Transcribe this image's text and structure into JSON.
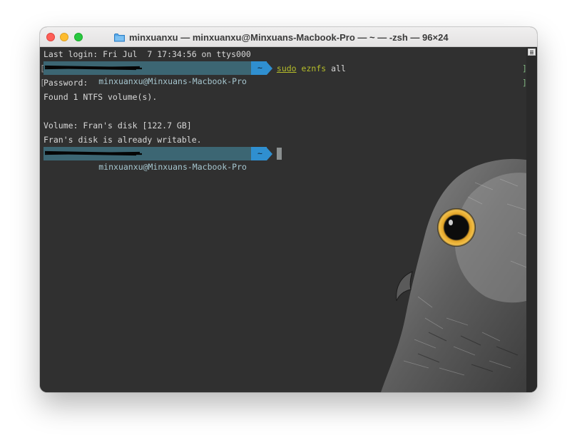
{
  "window": {
    "title": "minxuanxu — minxuanxu@Minxuans-Macbook-Pro — ~ — -zsh — 96×24"
  },
  "icons": {
    "close": "close-traffic-light-icon",
    "minimize": "minimize-traffic-light-icon",
    "zoom": "zoom-traffic-light-icon",
    "folder": "folder-icon",
    "scroll": "scroll-lines-icon"
  },
  "colors": {
    "background": "#303030",
    "prompt_host_bg": "#3c6673",
    "prompt_dir_bg": "#2f8fd0",
    "command_color": "#b5bd2a",
    "text": "#d8d8d8"
  },
  "terminal": {
    "last_login": "Last login: Fri Jul  7 17:34:56 on ttys000",
    "prompt1": {
      "host": "minxuanxu@Minxuans-Macbook-Pro",
      "host_visible": "-Macbook-Pro",
      "dir": "~",
      "cmd_sudo": "sudo",
      "cmd_name": "eznfs",
      "cmd_arg": "all"
    },
    "password": "Password:",
    "found": "Found 1 NTFS volume(s).",
    "volume": "Volume: Fran's disk [122.7 GB]",
    "writable": "Fran's disk is already writable.",
    "prompt2": {
      "host": "minxuanxu@Minxuans-Macbook-Pro",
      "host_visible": "-Macbook-Pro",
      "dir": "~"
    }
  }
}
